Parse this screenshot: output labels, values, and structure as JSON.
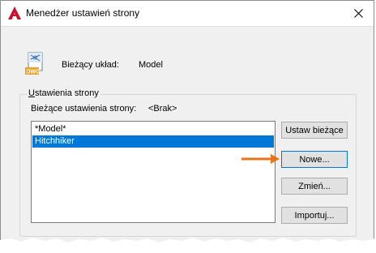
{
  "window": {
    "title": "Menedżer ustawień strony",
    "close_glyph": "✕"
  },
  "current_layout": {
    "label": "Bieżący układ:",
    "value": "Model",
    "icon": "dwg-file-icon",
    "icon_text": "DWG"
  },
  "page_setups": {
    "group_title": "Ustawienia strony",
    "current_label": "Bieżące ustawienia strony:",
    "current_value": "<Brak>",
    "items": [
      {
        "label": "*Model*",
        "selected": false
      },
      {
        "label": "Hitchhiker",
        "selected": true
      }
    ]
  },
  "buttons": {
    "set_current": "Ustaw bieżące",
    "new": "Nowe...",
    "modify": "Zmień...",
    "import": "Importuj..."
  },
  "colors": {
    "selection": "#0078d7",
    "accent_arrow": "#e8731a",
    "app_icon": "#c8102e"
  }
}
